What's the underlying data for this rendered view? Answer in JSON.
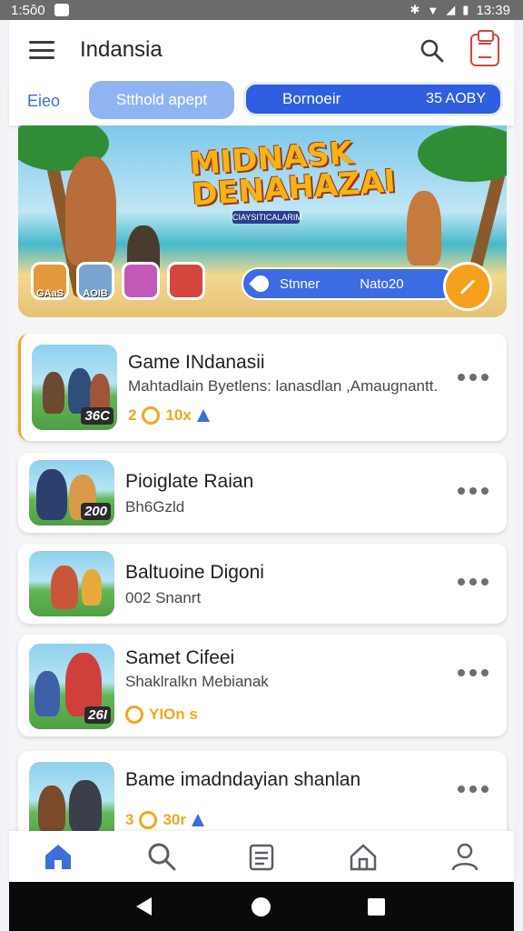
{
  "status_bar": {
    "time_left": "1:5ô0",
    "time_right": "13:39"
  },
  "app_bar": {
    "title": "Indansia"
  },
  "tabs": {
    "plain": "Eieo",
    "pill_light": "Stthold apept",
    "pill_dark": "Bornoeir",
    "pill_dark_sub": "35 AOBY"
  },
  "hero": {
    "title": "MIDNASK DENAHAZAI",
    "subtitle": "CIAYSITICALARIM",
    "avatars": [
      "GAaS",
      "AOIB",
      "",
      ""
    ],
    "pill_label_1": "Stnner",
    "pill_label_2": "Nato20"
  },
  "games": [
    {
      "title": "Game INdanasii",
      "subtitle": "Mahtadlain Byetlens: lanasdlan ,Amaugnantt.",
      "count": "36C",
      "stat_coin": "2",
      "stat_value": "10x"
    },
    {
      "title": "Pioiglate Raian",
      "subtitle": "Bh6Gzld",
      "count": "200"
    },
    {
      "title": "Baltuoine Digoni",
      "subtitle": "002 Snanrt"
    },
    {
      "title": "Samet Cifeei",
      "subtitle": "Shaklralkn Mebianak",
      "count": "26I",
      "stat_value": "YIOn s"
    },
    {
      "title": "Bame imadndayian shanlan",
      "stat_coin": "3",
      "stat_value": "30r"
    }
  ],
  "colors": {
    "accent": "#3d6fd8",
    "orange": "#f0a81c",
    "red": "#d2453c"
  },
  "icons": [
    "home-icon",
    "search-icon",
    "news-icon",
    "house-icon",
    "profile-icon"
  ]
}
